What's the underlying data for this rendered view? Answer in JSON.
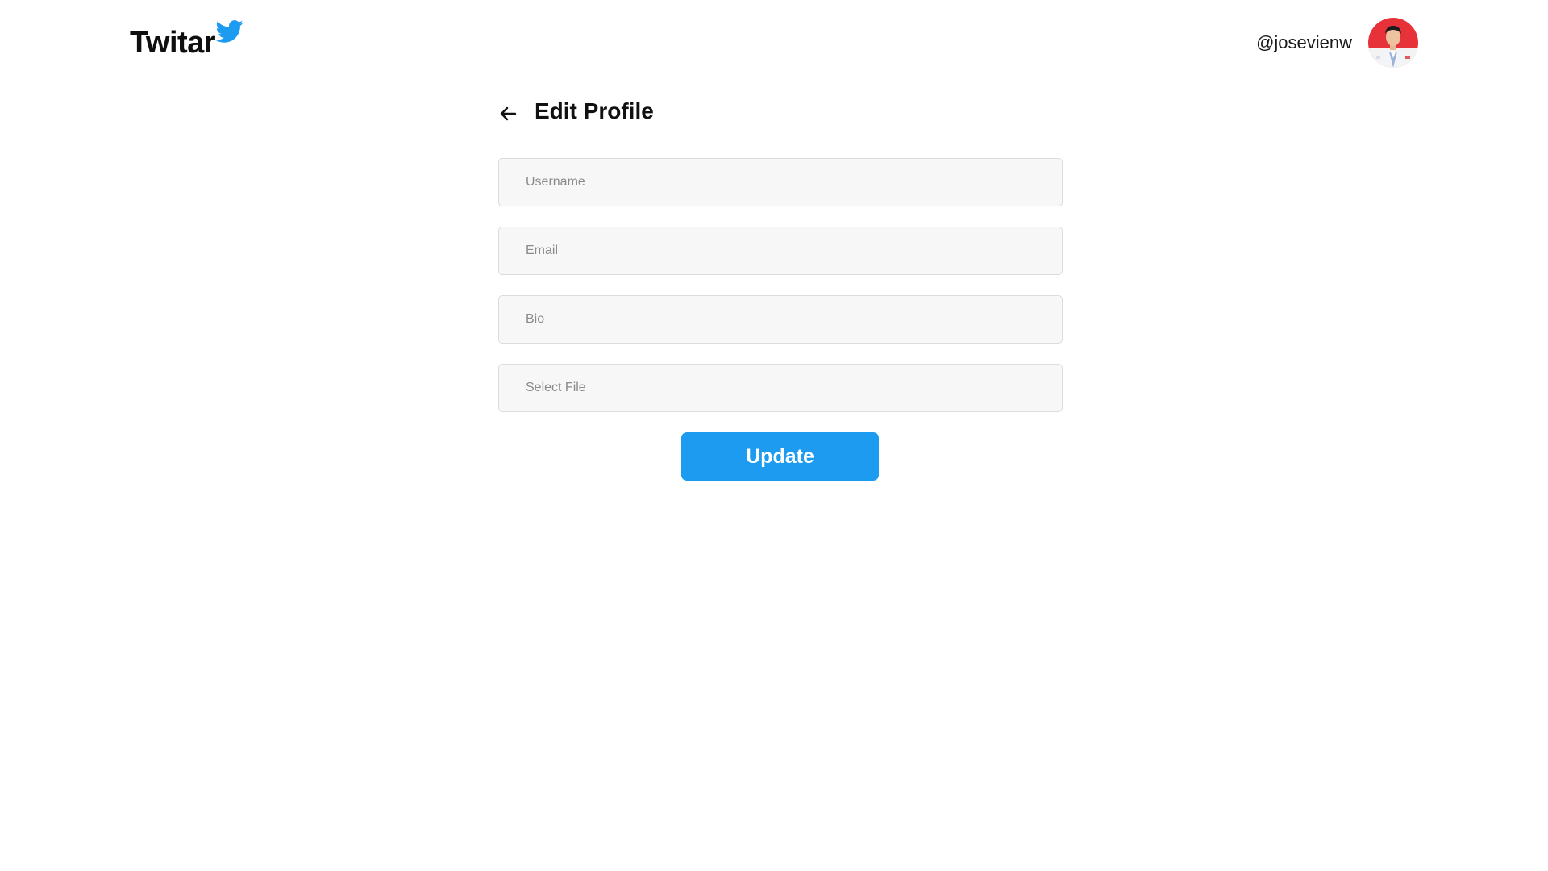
{
  "app": {
    "logo_text": "Twitar",
    "logo_icon": "bird-icon",
    "brand_color": "#1d9bf0"
  },
  "user": {
    "handle": "@josevienw",
    "avatar_icon": "avatar"
  },
  "page": {
    "title": "Edit Profile",
    "back_icon": "arrow-left-icon"
  },
  "form": {
    "username": {
      "placeholder": "Username",
      "value": ""
    },
    "email": {
      "placeholder": "Email",
      "value": ""
    },
    "bio": {
      "placeholder": "Bio",
      "value": ""
    },
    "file": {
      "placeholder": "Select File"
    },
    "submit_label": "Update"
  }
}
